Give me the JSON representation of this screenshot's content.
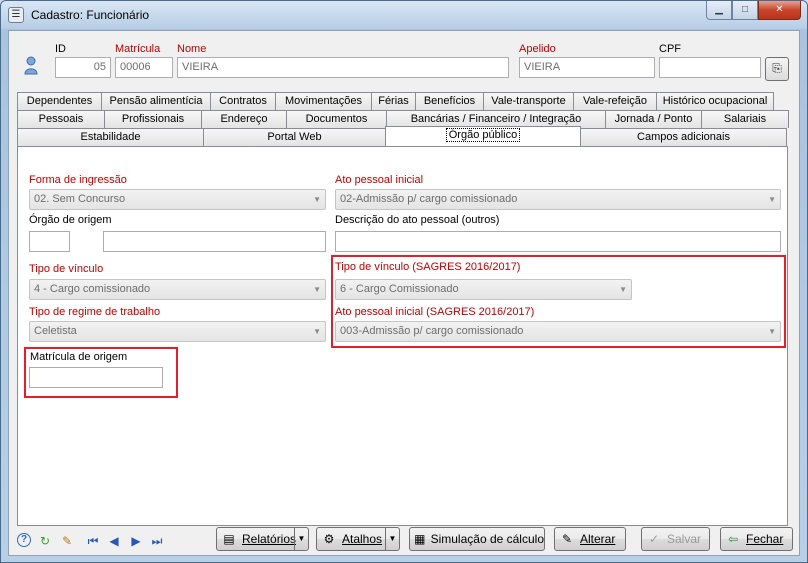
{
  "window": {
    "title": "Cadastro: Funcionário",
    "min_glyph": "▁",
    "max_glyph": "□",
    "close_glyph": "✕",
    "app_glyph": "☰"
  },
  "header": {
    "id_label": "ID",
    "id_value": "05",
    "matricula_label": "Matrícula",
    "matricula_value": "00006",
    "nome_label": "Nome",
    "nome_value": "VIEIRA",
    "apelido_label": "Apelido",
    "apelido_value": "VIEIRA",
    "cpf_label": "CPF",
    "cpf_value": "",
    "cpf_button_icon": "⎘"
  },
  "tabs": {
    "row1": [
      "Dependentes",
      "Pensão alimentícia",
      "Contratos",
      "Movimentações",
      "Férias",
      "Benefícios",
      "Vale-transporte",
      "Vale-refeição",
      "Histórico ocupacional"
    ],
    "row2": [
      "Pessoais",
      "Profissionais",
      "Endereço",
      "Documentos",
      "Bancárias / Financeiro / Integração",
      "Jornada / Ponto",
      "Salariais"
    ],
    "row3": [
      "Estabilidade",
      "Portal Web",
      "Órgão público",
      "Campos adicionais"
    ],
    "active": "Órgão público"
  },
  "form": {
    "forma_ingresso_label": "Forma de ingressão",
    "forma_ingresso_value": "02. Sem Concurso",
    "ato_pessoal_label": "Ato pessoal inicial",
    "ato_pessoal_value": "02-Admissão p/ cargo comissionado",
    "orgao_origem_label": "Órgão de origem",
    "orgao_origem_code": "",
    "orgao_origem_name": "",
    "descricao_ato_label": "Descrição do ato pessoal (outros)",
    "descricao_ato_value": "",
    "tipo_vinculo_label": "Tipo de vínculo",
    "tipo_vinculo_value": "4 - Cargo comissionado",
    "tipo_vinculo_sagres_label": "Tipo de vínculo (SAGRES 2016/2017)",
    "tipo_vinculo_sagres_value": "6 - Cargo Comissionado",
    "tipo_regime_label": "Tipo de regime de trabalho",
    "tipo_regime_value": "Celetista",
    "ato_pessoal_sagres_label": "Ato pessoal inicial (SAGRES 2016/2017)",
    "ato_pessoal_sagres_value": "003-Admissão p/ cargo comissionado",
    "matricula_origem_label": "Matrícula de origem",
    "matricula_origem_value": "",
    "dropdown_arrow": "▼"
  },
  "toolbar": {
    "help_icon": "?",
    "refresh_icon": "↻",
    "notes_icon": "✎",
    "first_icon": "⏮",
    "prev_icon": "◀",
    "next_icon": "▶",
    "last_icon": "⏭",
    "relatorios_label": "Relatórios",
    "atalhos_label": "Atalhos",
    "simulacao_label": "Simulação de cálculo",
    "alterar_label": "Alterar",
    "salvar_label": "Salvar",
    "fechar_label": "Fechar",
    "split_arrow": "▼",
    "relatorios_icon": "▤",
    "atalhos_icon": "⚙",
    "simulacao_icon": "▦",
    "alterar_icon": "✎",
    "salvar_icon": "✓",
    "fechar_icon": "⇦"
  },
  "colors": {
    "required_label": "#c00000",
    "highlight_box": "#e0202a"
  }
}
